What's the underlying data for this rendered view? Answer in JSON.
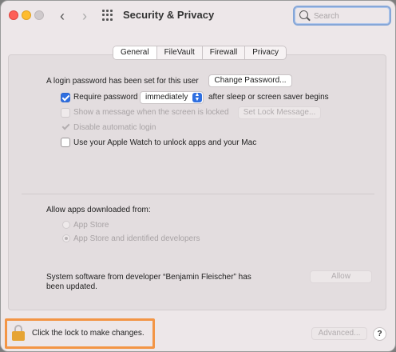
{
  "window": {
    "title": "Security & Privacy",
    "search_placeholder": "Search"
  },
  "tabs": [
    "General",
    "FileVault",
    "Firewall",
    "Privacy"
  ],
  "general": {
    "login_text": "A login password has been set for this user",
    "change_password_button": "Change Password...",
    "require_password_label": "Require password",
    "require_password_checked": true,
    "require_password_delay": "immediately",
    "require_password_suffix": "after sleep or screen saver begins",
    "show_message_label": "Show a message when the screen is locked",
    "set_lock_message_button": "Set Lock Message...",
    "disable_auto_login_label": "Disable automatic login",
    "apple_watch_label": "Use your Apple Watch to unlock apps and your Mac"
  },
  "downloads": {
    "heading": "Allow apps downloaded from:",
    "options": [
      "App Store",
      "App Store and identified developers"
    ],
    "selected": "App Store and identified developers"
  },
  "system_software": {
    "message_line1": "System software from developer “Benjamin Fleischer” has",
    "message_line2": "been updated.",
    "allow_button": "Allow"
  },
  "footer": {
    "lock_text": "Click the lock to make changes.",
    "advanced_button": "Advanced...",
    "help_button": "?"
  },
  "icons": {
    "lock": "lock-icon",
    "search": "search-icon",
    "back": "chevron-left-icon",
    "forward": "chevron-right-icon",
    "grid": "grid-icon"
  },
  "colors": {
    "accent": "#2f6fe0",
    "highlight": "#f39545",
    "lock": "#e6a434"
  }
}
